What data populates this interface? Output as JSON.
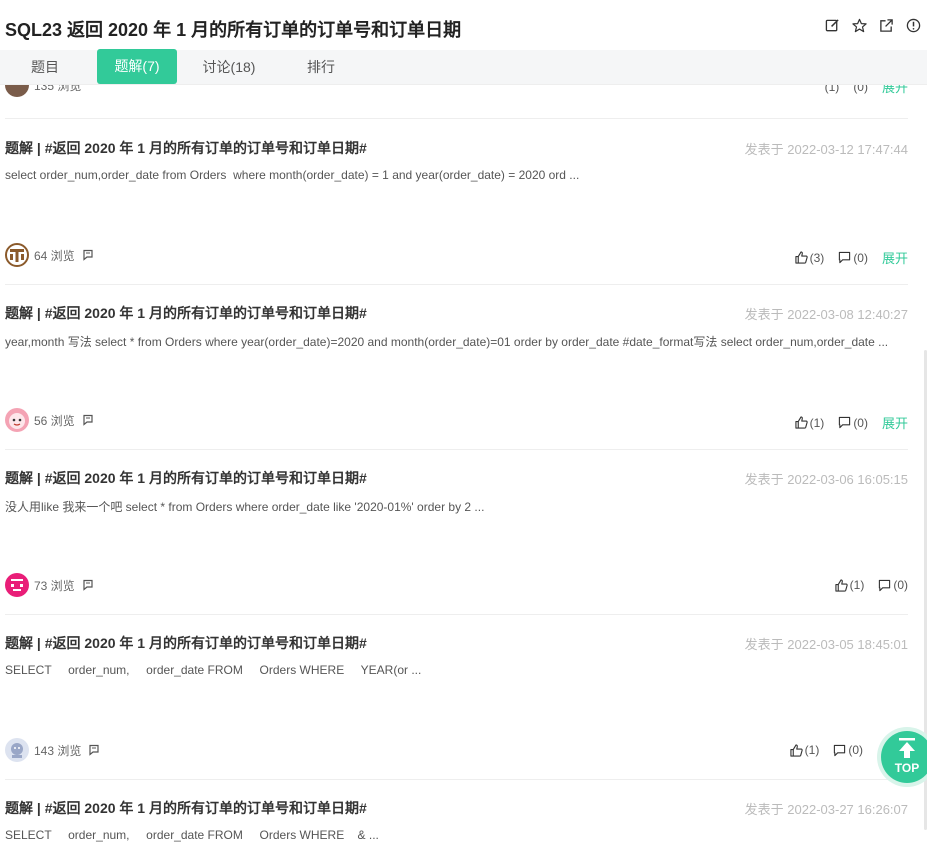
{
  "header": {
    "title": "SQL23  返回 2020 年 1 月的所有订单的订单号和订单日期",
    "icons": [
      "edit-icon",
      "star-icon",
      "share-icon",
      "report-icon"
    ]
  },
  "tabs": [
    {
      "label": "题目"
    },
    {
      "label": "题解(7)"
    },
    {
      "label": "讨论(18)"
    },
    {
      "label": "排行"
    }
  ],
  "top_partial": {
    "views": "135 浏览",
    "likes": "(1)",
    "comments": "(0)",
    "expand": "展开"
  },
  "posts": [
    {
      "title": "题解 | #返回 2020 年 1 月的所有订单的订单号和订单日期#",
      "date": "发表于 2022-03-12 17:47:44",
      "excerpt": "select order_num,order_date from Orders  where month(order_date) = 1 and year(order_date) = 2020 ord ...",
      "views": "64 浏览",
      "likes": "(3)",
      "comments": "(0)",
      "expand": "展开",
      "avatar_color": "#8b5a2b"
    },
    {
      "title": "题解 | #返回 2020 年 1 月的所有订单的订单号和订单日期#",
      "date": "发表于 2022-03-08 12:40:27",
      "excerpt": "year,month 写法 select * from Orders where year(order_date)=2020 and month(order_date)=01 order by order_date #date_format写法 select order_num,order_date ...",
      "views": "56 浏览",
      "likes": "(1)",
      "comments": "(0)",
      "expand": "展开",
      "avatar_color": "#f4a3b4"
    },
    {
      "title": "题解 | #返回 2020 年 1 月的所有订单的订单号和订单日期#",
      "date": "发表于 2022-03-06 16:05:15",
      "excerpt": "没人用like 我来一个吧 select * from Orders where order_date like '2020-01%' order by 2 ...",
      "views": "73 浏览",
      "likes": "(1)",
      "comments": "(0)",
      "expand": "",
      "avatar_color": "#e91e78"
    },
    {
      "title": "题解 | #返回 2020 年 1 月的所有订单的订单号和订单日期#",
      "date": "发表于 2022-03-05 18:45:01",
      "excerpt": "SELECT     order_num,     order_date FROM     Orders WHERE     YEAR(or ...",
      "views": "143 浏览",
      "likes": "(1)",
      "comments": "(0)",
      "expand": "",
      "avatar_color": "#9aa7c7"
    },
    {
      "title": "题解 | #返回 2020 年 1 月的所有订单的订单号和订单日期#",
      "date": "发表于 2022-03-27 16:26:07",
      "excerpt": "SELECT     order_num,     order_date FROM     Orders WHERE    & ..."
    }
  ],
  "top_button": {
    "label": "TOP"
  },
  "colors": {
    "accent": "#32ca99",
    "date": "#bbbbbb"
  }
}
